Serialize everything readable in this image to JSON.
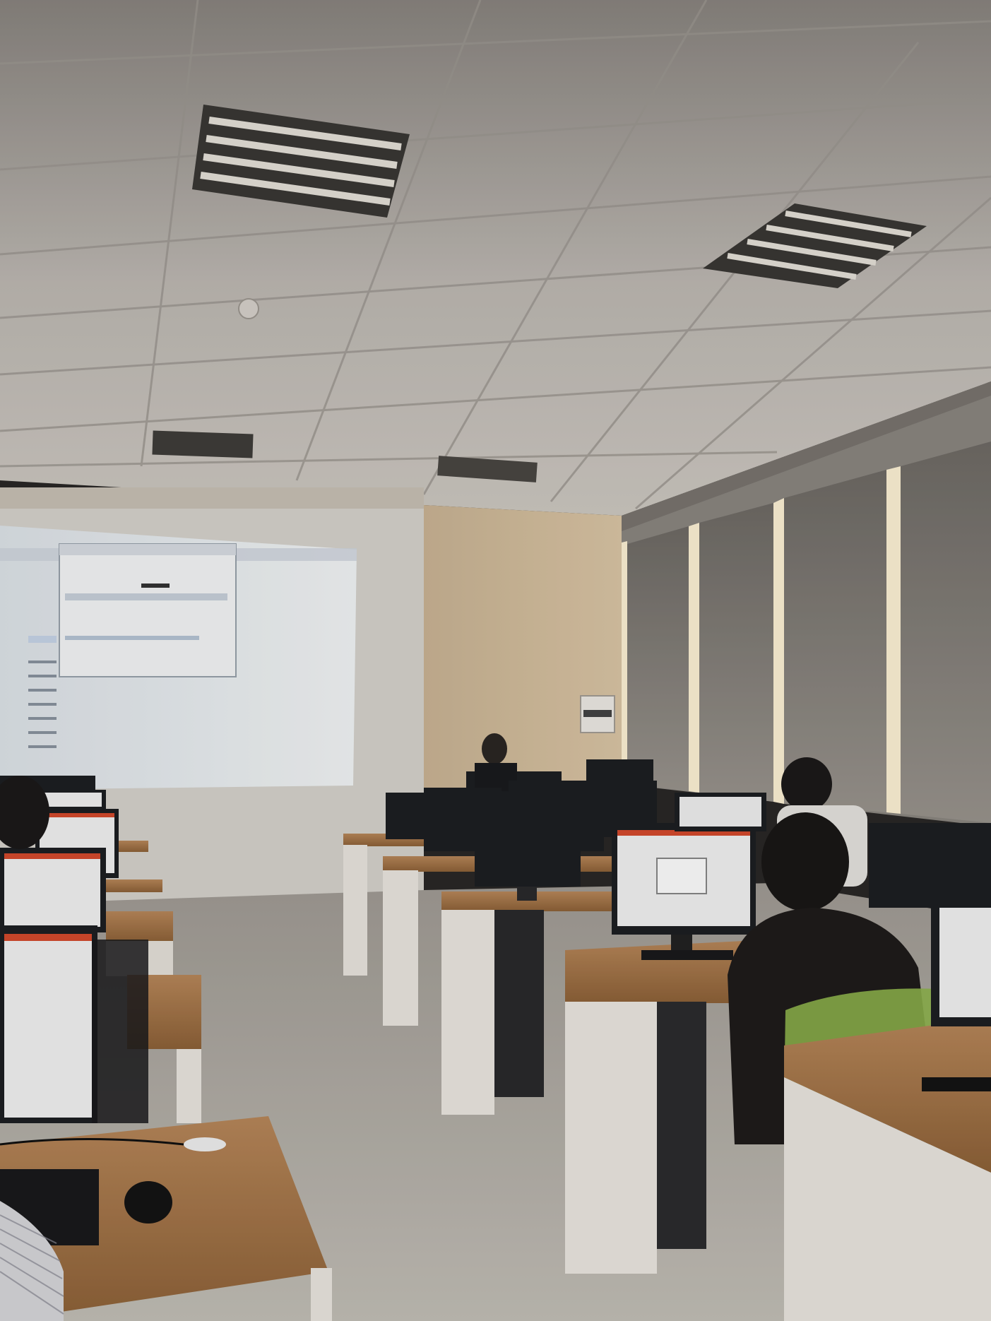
{
  "scene": {
    "subject": "computer-lab-classroom",
    "colors": {
      "ceiling": "#cfcbc6",
      "ceiling_shadow": "#8f8a85",
      "wall_beige": "#d9c3a2",
      "window_shade": "#8a8680",
      "light_strip": "#fff5dc",
      "projection": "#e9eef2",
      "floor": "#b9b5ae",
      "desk_top": "#a9794b",
      "desk_body": "#eeeae4",
      "monitor": "#1d1f22",
      "monitor_screen_on": "#f2f2f2",
      "screen_accent": "#d54a2d"
    }
  }
}
